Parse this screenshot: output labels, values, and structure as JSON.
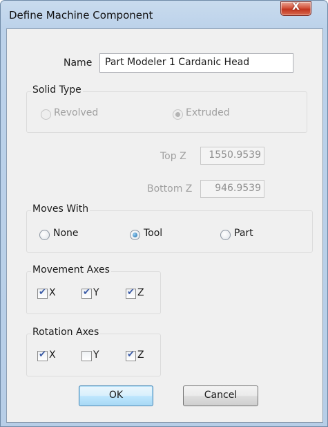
{
  "window": {
    "title": "Define Machine Component",
    "close_glyph": "X"
  },
  "name_field": {
    "label": "Name",
    "value": "Part Modeler 1 Cardanic Head"
  },
  "solid_type": {
    "caption": "Solid Type",
    "revolved_label": "Revolved",
    "extruded_label": "Extruded",
    "selected": "Extruded",
    "enabled": false
  },
  "top_z": {
    "label": "Top Z",
    "value": "1550.9539"
  },
  "bottom_z": {
    "label": "Bottom Z",
    "value": "946.9539"
  },
  "moves_with": {
    "caption": "Moves With",
    "none_label": "None",
    "tool_label": "Tool",
    "part_label": "Part",
    "selected": "Tool"
  },
  "movement_axes": {
    "caption": "Movement Axes",
    "x_label": "X",
    "y_label": "Y",
    "z_label": "Z",
    "checked": {
      "x": true,
      "y": true,
      "z": true
    }
  },
  "rotation_axes": {
    "caption": "Rotation Axes",
    "x_label": "X",
    "y_label": "Y",
    "z_label": "Z",
    "checked": {
      "x": true,
      "y": false,
      "z": true
    }
  },
  "buttons": {
    "ok_label": "OK",
    "cancel_label": "Cancel"
  }
}
